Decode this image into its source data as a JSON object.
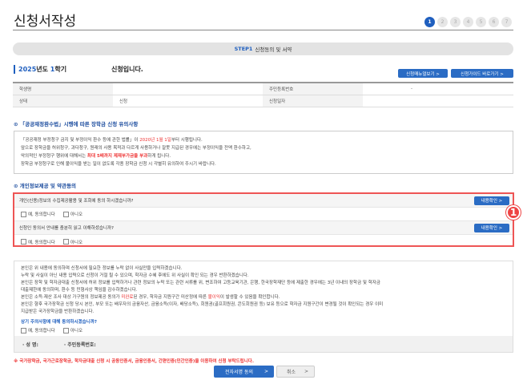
{
  "title": "신청서작성",
  "steps": [
    "1",
    "2",
    "3",
    "4",
    "5",
    "6",
    "7"
  ],
  "step_bar": {
    "step": "STEP1",
    "label": "신청동의 및 서약"
  },
  "term": {
    "year": "2025",
    "year_suffix": "년도 ",
    "sem": "1",
    "sem_suffix": "학기",
    "applied": "신청입니다."
  },
  "buttons": {
    "manual": "신청매뉴얼보기 >",
    "guide": "신청가이드 바로가기 >",
    "confirm": "내용확인 >",
    "sign": "전자서명 동의",
    "sign_arrow": ">",
    "cancel": "취소",
    "cancel_arrow": ">"
  },
  "info": {
    "name_label": "학생명",
    "name_value": "",
    "rrn_label": "주민등록번호",
    "rrn_value": "-",
    "status_label": "상태",
    "status_value": "신청",
    "date_label": "신청일자",
    "date_value": ""
  },
  "notice": {
    "heading": "「공공재정환수법」시행에 따른 장학금 신청 유의사항",
    "l1a": "「공공재정 부정청구 금지 및 부정이익 환수 등에 관한 법률」이 ",
    "l1b": "2020년 1월 1일",
    "l1c": "부터 시행됩니다.",
    "l2": "앞으로 장학금을 허위청구, 과다청구, 원래의 사용 목적과 다르게 사용하거나 잘못 지급된 경우에는 부정이익을 전액 환수하고,",
    "l3a": "악의적인 부정청구 행위에 대해서는 ",
    "l3b": "최대 5배까지 제재부가금을 부과",
    "l3c": "하게 됩니다.",
    "l4": "장학금 부정청구로 인해 불이익을 받는 일이 없도록 각종 장학금 신청 시 각별히 유의하여 주시기 바랍니다."
  },
  "consent": {
    "heading": "개인정보제공 및 약관동의",
    "badge": "1",
    "q1": "개인(신용)정보의 수집제공활용 및 조회에 동의 하시겠습니까?",
    "q2": "신청인 동의서 안내를 충분히 읽고 이해하셨습니까?",
    "yes": "예, 동의합니다",
    "no": "아니오"
  },
  "pledge": {
    "l1": "본인은 위 내용에 동의하며 신청서에 필요한 정보를 누락 없이 사실만을 입력하겠습니다.",
    "l2": "누락 및 사실이 아닌 내용 입력으로 신청이 거절 될 수 있으며, 학자금 수혜 후에도 위 사실이 확인 되는 경우 반환하겠습니다.",
    "l3": "본인은 장학 및 학자금대출 신청서에 허위 정보를 입력하거나 관련 정보의 누락 또는 관련 서류를 위, 변조하여 고등교육기관, 은행, 한국장학재단 등에 제출한 경우에는 3년 이내의 장학금 및 학자금",
    "l4": "대출제한에 동의하며, 환수 등 민형사상 책임을 감수하겠습니다.",
    "l5a": "본인은 소득·재산 조사 대상 가구원의 정보제공 동의가 ",
    "l5b": "미완료",
    "l5c": "된 경우, 학자금 지원구간 미산정에 따른 ",
    "l5d": "불이익",
    "l5e": "이 발생할 수 있음을 확인합니다.",
    "l6": "본인은 향후 국가장학금 신청 당시 본인, 부모 또는 배우자의 금융자산, 금융소득(이자, 배당소득), 회원권(골프회원권, 콘도회원권 등) 보유 등으로 학자금 지원구간이 변경될 것이 확인되는 경우 이미",
    "l7": "지급받은 국가장학금을 반환하겠습니다.",
    "question": "상기 주의사항에 대해 동의하시겠습니까?",
    "name_label": "· 성 명:",
    "rrn_label": "· 주민등록번호:"
  },
  "warning": "※ 국가장학금, 국가근로장학금, 학자금대출 신청 시 공동인증서, 금융인증서, 간편인증(민간인증)을 이용하여 신청 부탁드립니다."
}
